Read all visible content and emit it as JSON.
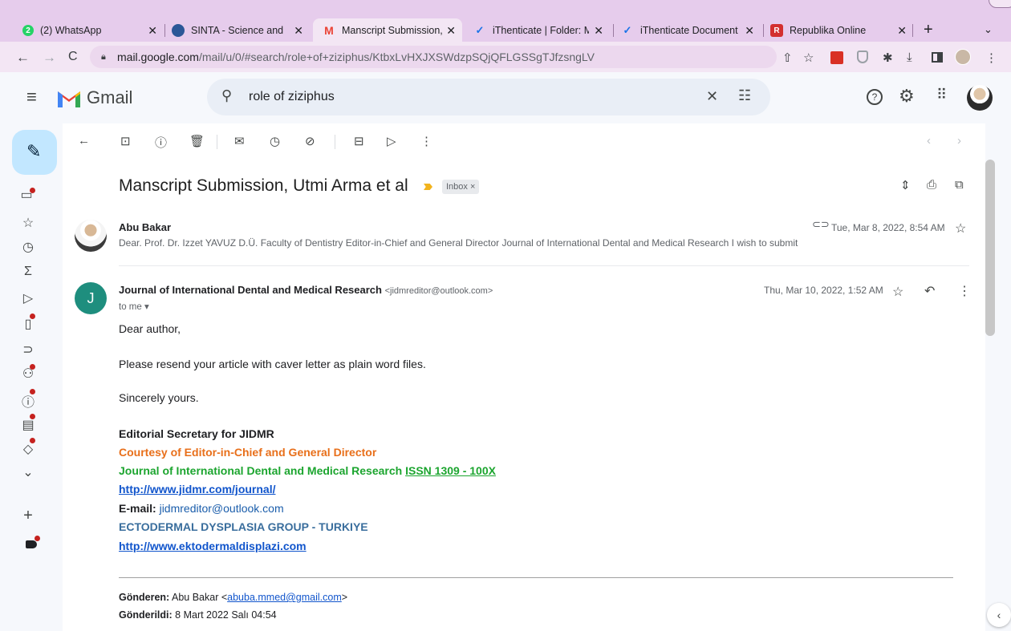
{
  "browser": {
    "tabs": [
      {
        "title": "(2) WhatsApp",
        "favicon": "whatsapp-icon",
        "color": "#25d366",
        "glyph": "2"
      },
      {
        "title": "SINTA - Science and T",
        "favicon": "sinta-icon",
        "color": "#2b5797",
        "glyph": ""
      },
      {
        "title": "Manscript Submission,",
        "favicon": "gmail-icon",
        "color": "#ea4335",
        "glyph": "M"
      },
      {
        "title": "iThenticate | Folder: M",
        "favicon": "check-icon",
        "color": "#1a73e8",
        "glyph": "✓"
      },
      {
        "title": "iThenticate Document",
        "favicon": "check-icon",
        "color": "#1a73e8",
        "glyph": "✓"
      },
      {
        "title": "Republika Online",
        "favicon": "republika-icon",
        "color": "#d32f2f",
        "glyph": "R"
      }
    ],
    "url_domain": "mail.google.com",
    "url_path": "/mail/u/0/#search/role+of+ziziphus/KtbxLvHXJXSWdzpSQjQFLGSSgTJfzsngLV"
  },
  "gmail": {
    "logo_text": "Gmail",
    "search_query": "role of ziziphus",
    "subject": "Manscript Submission, Utmi Arma et al",
    "label_chip": "Inbox",
    "message1": {
      "sender": "Abu Bakar",
      "date": "Tue, Mar 8, 2022, 8:54 AM",
      "snippet": "Dear. Prof. Dr. Izzet YAVUZ D.Ü. Faculty of Dentistry Editor-in-Chief and General Director Journal of International Dental and Medical Research I wish to submit"
    },
    "message2": {
      "avatar_letter": "J",
      "avatar_color": "#1e8e7e",
      "sender": "Journal of International Dental and Medical Research",
      "sender_email": "<jidmreditor@outlook.com>",
      "to": "to me",
      "date": "Thu, Mar 10, 2022, 1:52 AM",
      "greeting": "Dear author,",
      "body1": "Please resend your article with caver letter as plain word files.",
      "closing": "Sincerely yours.",
      "sig_title": "Editorial Secretary for JIDMR",
      "sig_courtesy": "Courtesy of Editor-in-Chief and General Director",
      "sig_journal": "Journal of International Dental and Medical Research",
      "sig_issn": "ISSN 1309 - 100X",
      "sig_url1": "http://www.jidmr.com/journal/",
      "sig_email_label": "E-mail:",
      "sig_email": "jidmreditor@outlook.com",
      "sig_group": "ECTODERMAL DYSPLASIA GROUP - TURKIYE",
      "sig_url2": "http://www.ektodermaldisplazi.com",
      "fwd_from_label": "Gönderen:",
      "fwd_from_name": "Abu Bakar",
      "fwd_from_email": "abuba.mmed@gmail.com",
      "fwd_sent_label": "Gönderildi:",
      "fwd_sent": "8 Mart 2022 Salı 04:54"
    }
  }
}
